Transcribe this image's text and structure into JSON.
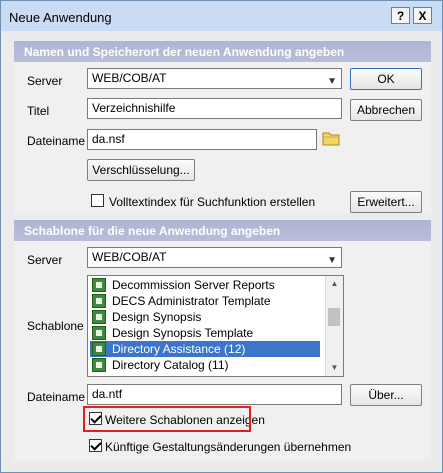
{
  "window": {
    "title": "Neue Anwendung",
    "help_label": "?",
    "close_label": "X"
  },
  "section1": {
    "header": "Namen und Speicherort der neuen Anwendung angeben",
    "server_label": "Server",
    "server_value": "WEB/COB/AT",
    "title_label": "Titel",
    "title_value": "Verzeichnishilfe",
    "filename_label": "Dateiname",
    "filename_value": "da.nsf",
    "encryption_button": "Verschlüsselung...",
    "fulltext_label": "Volltextindex für Suchfunktion erstellen",
    "fulltext_checked": false,
    "advanced_button": "Erweitert..."
  },
  "buttons": {
    "ok": "OK",
    "cancel": "Abbrechen"
  },
  "section2": {
    "header": "Schablone für die neue Anwendung angeben",
    "server_label": "Server",
    "server_value": "WEB/COB/AT",
    "template_label": "Schablone",
    "templates": [
      {
        "label": "Decommission Server Reports",
        "selected": false
      },
      {
        "label": "DECS Administrator Template",
        "selected": false
      },
      {
        "label": "Design Synopsis",
        "selected": false
      },
      {
        "label": "Design Synopsis Template",
        "selected": false
      },
      {
        "label": "Directory Assistance (12)",
        "selected": true
      },
      {
        "label": "Directory Catalog (11)",
        "selected": false
      }
    ],
    "filename_label": "Dateiname",
    "filename_value": "da.ntf",
    "about_button": "Über...",
    "show_more_label": "Weitere Schablonen anzeigen",
    "show_more_checked": true,
    "inherit_label": "Künftige Gestaltungsänderungen übernehmen",
    "inherit_checked": true
  },
  "icons": {
    "folder": "folder-icon",
    "template": "notes-database-icon",
    "dropdown": "chevron-down-icon"
  },
  "colors": {
    "highlight": "#e02020",
    "selection": "#3c75c9",
    "group_header": "#aeb5d3"
  }
}
